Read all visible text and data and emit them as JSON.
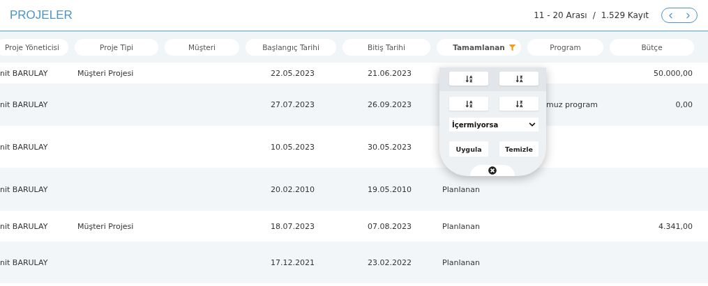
{
  "title": "PROJELER",
  "pagination": {
    "range": "11 - 20 Arası",
    "separator": "/",
    "total": "1.529 Kayıt"
  },
  "columns": [
    {
      "label": "Proje Yöneticisi",
      "filtered": false
    },
    {
      "label": "Proje Tipi",
      "filtered": false
    },
    {
      "label": "Müşteri",
      "filtered": false
    },
    {
      "label": "Başlangıç Tarihi",
      "filtered": false
    },
    {
      "label": "Bitiş Tarihi",
      "filtered": false
    },
    {
      "label": "Tamamlanan",
      "filtered": true
    },
    {
      "label": "Program",
      "filtered": false
    },
    {
      "label": "Bütçe",
      "filtered": false
    }
  ],
  "rows": [
    {
      "cells": [
        "nit BARULAY",
        "Müşteri Projesi",
        "",
        "22.05.2023",
        "21.06.2023",
        "",
        "",
        "50.000,00"
      ]
    },
    {
      "cells": [
        "nit BARULAY",
        "",
        "",
        "27.07.2023",
        "26.09.2023",
        "",
        "muz program",
        "0,00"
      ]
    },
    {
      "cells": [
        "nit BARULAY",
        "",
        "",
        "10.05.2023",
        "30.05.2023",
        "",
        "",
        ""
      ]
    },
    {
      "cells": [
        "nit BARULAY",
        "",
        "",
        "20.02.2010",
        "19.05.2010",
        "Planlanan",
        "",
        ""
      ]
    },
    {
      "cells": [
        "nit BARULAY",
        "Müşteri Projesi",
        "",
        "18.07.2023",
        "07.08.2023",
        "Planlanan",
        "",
        "4.341,00"
      ]
    },
    {
      "cells": [
        "nit BARULAY",
        "",
        "",
        "17.12.2021",
        "23.02.2022",
        "Planlanan",
        "",
        ""
      ]
    }
  ],
  "filter_popup": {
    "sort_buttons": [
      {
        "kind": "asc"
      },
      {
        "kind": "desc"
      },
      {
        "kind": "asc"
      },
      {
        "kind": "desc"
      }
    ],
    "condition": "İçermiyorsa",
    "buttons": [
      "Uygula",
      "Temizle"
    ]
  }
}
